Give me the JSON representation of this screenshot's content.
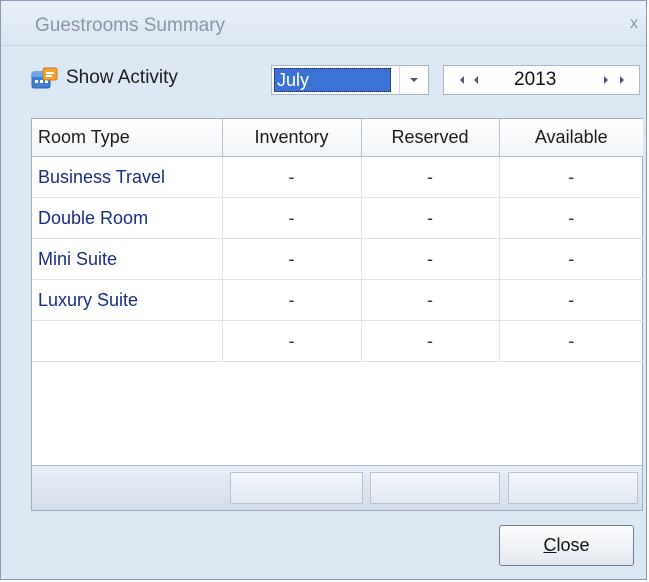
{
  "window": {
    "title": "Guestrooms Summary",
    "close_glyph": "x"
  },
  "toolbar": {
    "show_activity_label": "Show Activity",
    "show_activity_icon": "calendar-activity-icon",
    "month_selected": "July",
    "year": "2013"
  },
  "grid": {
    "columns": [
      "Room Type",
      "Inventory",
      "Reserved",
      "Available"
    ],
    "rows": [
      {
        "room_type": "Business Travel",
        "inventory": "-",
        "reserved": "-",
        "available": "-"
      },
      {
        "room_type": "Double Room",
        "inventory": "-",
        "reserved": "-",
        "available": "-"
      },
      {
        "room_type": "Mini Suite",
        "inventory": "-",
        "reserved": "-",
        "available": "-"
      },
      {
        "room_type": "Luxury Suite",
        "inventory": "-",
        "reserved": "-",
        "available": "-"
      },
      {
        "room_type": "",
        "inventory": "-",
        "reserved": "-",
        "available": "-"
      }
    ]
  },
  "footer": {
    "close_accel": "C",
    "close_rest": "lose"
  },
  "colors": {
    "room_type_text": "#1b2c86",
    "selection": "#3b72d6"
  }
}
